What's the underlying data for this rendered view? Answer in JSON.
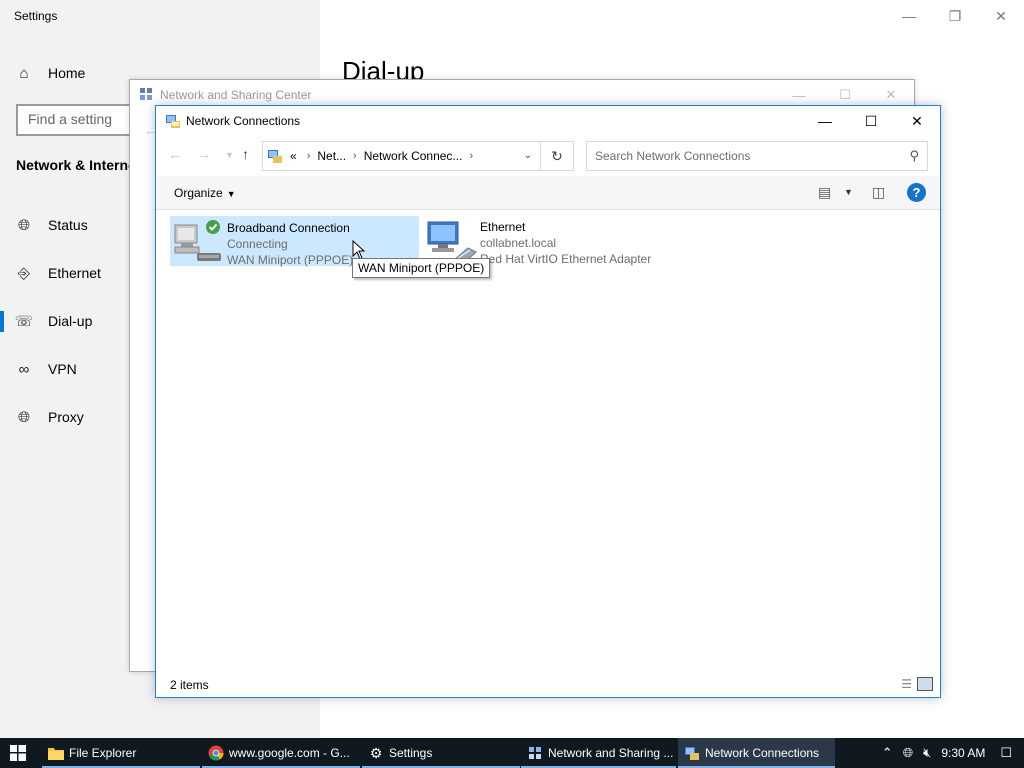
{
  "settings": {
    "app_title": "Settings",
    "nav_home": "Home",
    "search_placeholder": "Find a setting",
    "section_title": "Network & Interne",
    "nav": [
      {
        "label": "Status"
      },
      {
        "label": "Ethernet"
      },
      {
        "label": "Dial-up"
      },
      {
        "label": "VPN"
      },
      {
        "label": "Proxy"
      }
    ],
    "active_nav": "Dial-up",
    "page_title": "Dial-up"
  },
  "nsc_window": {
    "title": "Network and Sharing Center"
  },
  "nc_window": {
    "title": "Network Connections",
    "address": {
      "overflow": "«",
      "crumbs": [
        "Net...",
        "Network Connec..."
      ]
    },
    "search_placeholder": "Search Network Connections",
    "toolbar": {
      "organize_label": "Organize",
      "help_label": "?"
    },
    "connections": [
      {
        "name": "Broadband Connection",
        "status": "Connecting",
        "device": "WAN Miniport (PPPOE)",
        "selected": true
      },
      {
        "name": "Ethernet",
        "status": "collabnet.local",
        "device": "Red Hat VirtIO Ethernet Adapter",
        "selected": false
      }
    ],
    "tooltip": "WAN Miniport (PPPOE)",
    "status_bar": {
      "item_count": "2 items"
    }
  },
  "taskbar": {
    "tasks": [
      {
        "label": "File Explorer"
      },
      {
        "label": "www.google.com - G..."
      },
      {
        "label": "Settings"
      },
      {
        "label": "Network and Sharing ..."
      },
      {
        "label": "Network Connections"
      }
    ],
    "active_task": "Network Connections",
    "clock": "9:30 AM"
  },
  "colors": {
    "accent": "#0078d7",
    "selection": "#cce8ff",
    "taskbar": "#101820"
  }
}
